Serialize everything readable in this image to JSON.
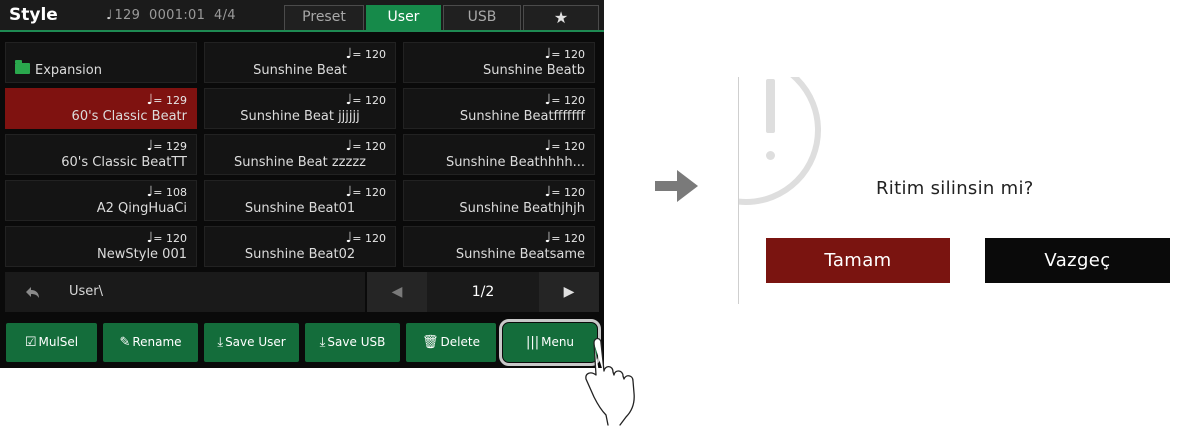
{
  "topbar": {
    "title": "Style",
    "tempo": "129",
    "position": "0001:01",
    "time_signature": "4/4",
    "tabs": [
      "Preset",
      "User",
      "USB"
    ],
    "active_tab": "User",
    "favorites_icon": "star-icon"
  },
  "grid": {
    "rows": [
      [
        {
          "bpm": "",
          "name": "Expansion",
          "folder": true
        },
        {
          "bpm": "= 120",
          "name": "Sunshine Beat"
        },
        {
          "bpm": "= 120",
          "name": "Sunshine Beatb"
        }
      ],
      [
        {
          "bpm": "= 129",
          "name": "60's Classic Beatr",
          "selected": true
        },
        {
          "bpm": "= 120",
          "name": "Sunshine Beat jjjjjj"
        },
        {
          "bpm": "= 120",
          "name": "Sunshine Beatfffffff"
        }
      ],
      [
        {
          "bpm": "= 129",
          "name": "60's Classic BeatTT"
        },
        {
          "bpm": "= 120",
          "name": "Sunshine Beat zzzzz"
        },
        {
          "bpm": "= 120",
          "name": "Sunshine Beathhhh..."
        }
      ],
      [
        {
          "bpm": "= 108",
          "name": "A2 QingHuaCi"
        },
        {
          "bpm": "= 120",
          "name": "Sunshine Beat01"
        },
        {
          "bpm": "= 120",
          "name": "Sunshine Beathjhjh"
        }
      ],
      [
        {
          "bpm": "= 120",
          "name": "NewStyle 001"
        },
        {
          "bpm": "= 120",
          "name": "Sunshine Beat02"
        },
        {
          "bpm": "= 120",
          "name": "Sunshine Beatsame"
        }
      ]
    ]
  },
  "path": {
    "text": "User\\"
  },
  "pager": {
    "label": "1/2"
  },
  "buttons": {
    "mulsel": "MulSel",
    "rename": "Rename",
    "save_user": "Save User",
    "save_usb": "Save USB",
    "delete": "Delete",
    "menu": "Menu"
  },
  "dialog": {
    "message": "Ritim silinsin mi?",
    "ok": "Tamam",
    "cancel": "Vazgeç"
  },
  "colors": {
    "accent": "#168a4a",
    "selected": "#7f1210",
    "ok_button": "#7a1410",
    "cancel_button": "#0a0a0a"
  }
}
